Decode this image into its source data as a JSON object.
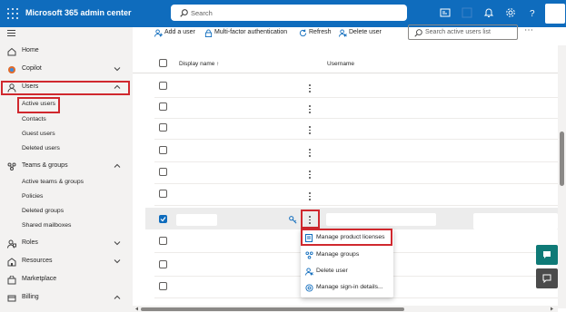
{
  "app": {
    "title": "Microsoft 365 admin center"
  },
  "top_search": {
    "placeholder": "Search"
  },
  "sidebar": {
    "items": [
      {
        "label": "Home",
        "icon": "home-icon"
      },
      {
        "label": "Copilot",
        "icon": "copilot-icon",
        "expandable": true
      },
      {
        "label": "Users",
        "icon": "user-icon",
        "expanded": true
      },
      {
        "label": "Teams & groups",
        "icon": "teams-groups-icon",
        "expanded": true
      },
      {
        "label": "Roles",
        "icon": "roles-icon",
        "expandable": true
      },
      {
        "label": "Resources",
        "icon": "resources-icon",
        "expandable": true
      },
      {
        "label": "Marketplace",
        "icon": "marketplace-icon"
      },
      {
        "label": "Billing",
        "icon": "billing-icon",
        "expandable": true
      }
    ],
    "users_children": [
      "Active users",
      "Contacts",
      "Guest users",
      "Deleted users"
    ],
    "teams_children": [
      "Active teams & groups",
      "Policies",
      "Deleted groups",
      "Shared mailboxes"
    ]
  },
  "toolbar": {
    "add_user": "Add a user",
    "mfa": "Multi-factor authentication",
    "refresh": "Refresh",
    "delete_user": "Delete user",
    "search_placeholder": "Search active users list",
    "more": "⋯"
  },
  "table": {
    "columns": [
      "Display name ↑",
      "Username"
    ],
    "selected_row": 7
  },
  "context_menu": {
    "items": [
      {
        "label": "Manage product licenses",
        "icon": "license-icon"
      },
      {
        "label": "Manage groups",
        "icon": "groups-icon"
      },
      {
        "label": "Delete user",
        "icon": "delete-user-icon"
      },
      {
        "label": "Manage sign-in details...",
        "icon": "sign-in-icon"
      }
    ]
  },
  "colors": {
    "brand": "#0f6cbd",
    "highlight": "#d0282e",
    "fab": "#0f7a77"
  }
}
